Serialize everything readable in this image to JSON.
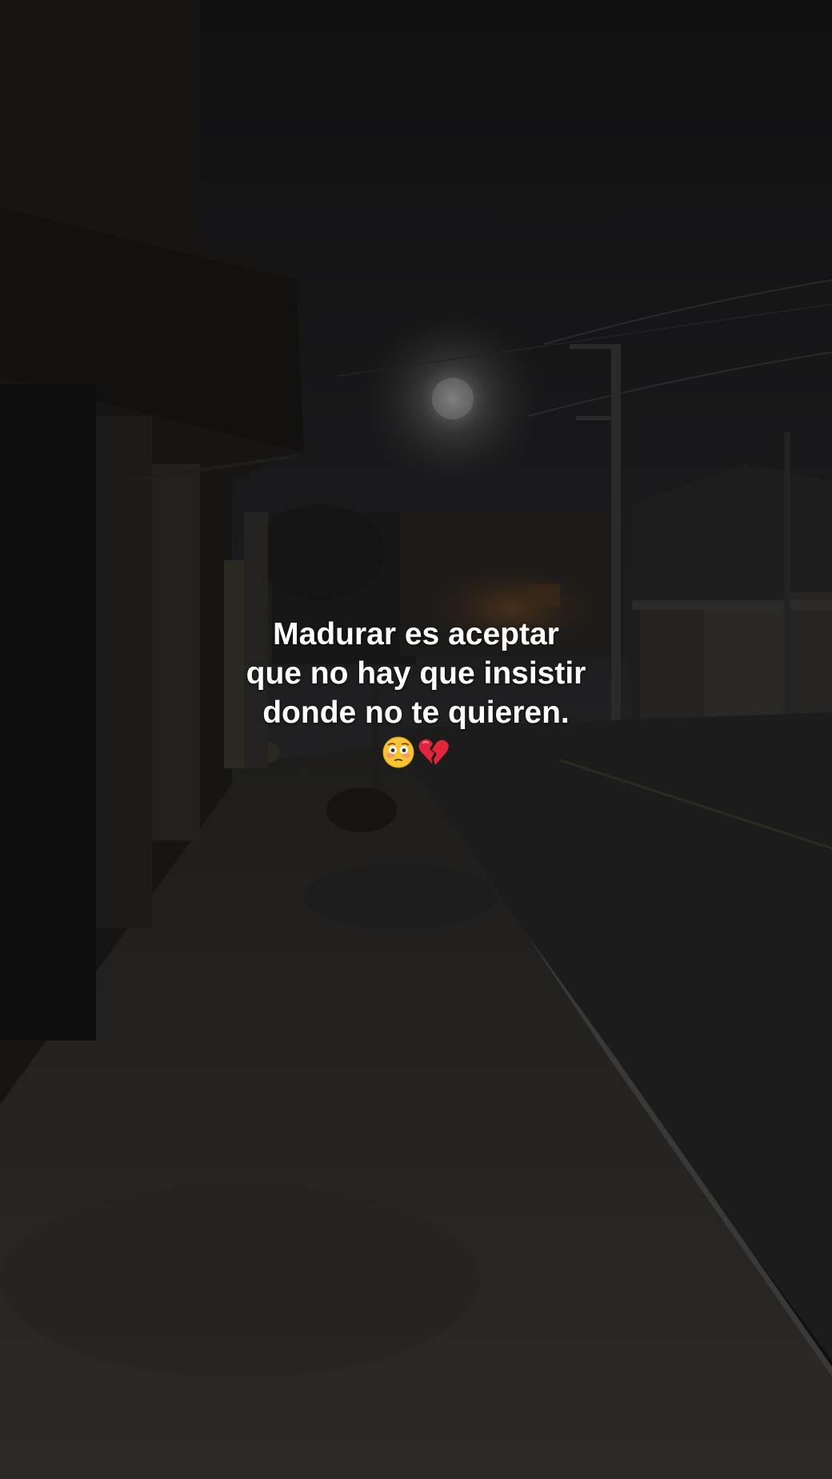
{
  "caption": {
    "lines": [
      "Madurar es aceptar",
      "que no hay que insistir",
      "donde no te quieren."
    ],
    "emojis": [
      "flushed-face-icon",
      "broken-heart-icon"
    ]
  },
  "scene": {
    "sky_color": "#141416",
    "ground_color": "#262422",
    "moon_glow_color": "#a8a8a8"
  }
}
